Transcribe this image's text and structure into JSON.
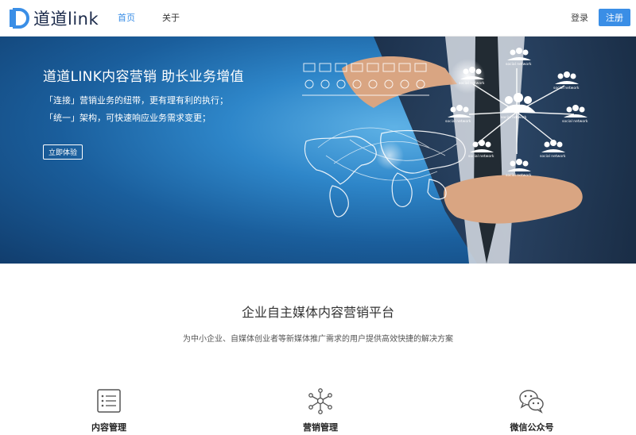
{
  "header": {
    "logo_text": "道道link",
    "nav": [
      {
        "label": "首页",
        "active": true
      },
      {
        "label": "关于",
        "active": false
      }
    ],
    "login_label": "登录",
    "signup_label": "注册"
  },
  "hero": {
    "title": "道道LINK内容营销 助长业务增值",
    "line1": "「连接」营销业务的纽带，更有理有利的执行；",
    "line2": "「统一」架构，可快速响应业务需求变更；",
    "button_label": "立即体验",
    "network_labels": [
      "social network",
      "social network",
      "social network",
      "social network",
      "social network",
      "social network",
      "social network",
      "social network",
      "social network"
    ]
  },
  "section": {
    "title": "企业自主媒体内容营销平台",
    "subtitle": "为中小企业、自媒体创业者等新媒体推广需求的用户提供高效快捷的解决方案"
  },
  "features": [
    {
      "label": "内容管理",
      "icon": "list-document-icon"
    },
    {
      "label": "营销管理",
      "icon": "network-nodes-icon"
    },
    {
      "label": "微信公众号",
      "icon": "wechat-icon"
    }
  ],
  "colors": {
    "accent": "#3a8ee6",
    "hero_dark": "#113d6d",
    "hero_light": "#5fb2e6"
  }
}
